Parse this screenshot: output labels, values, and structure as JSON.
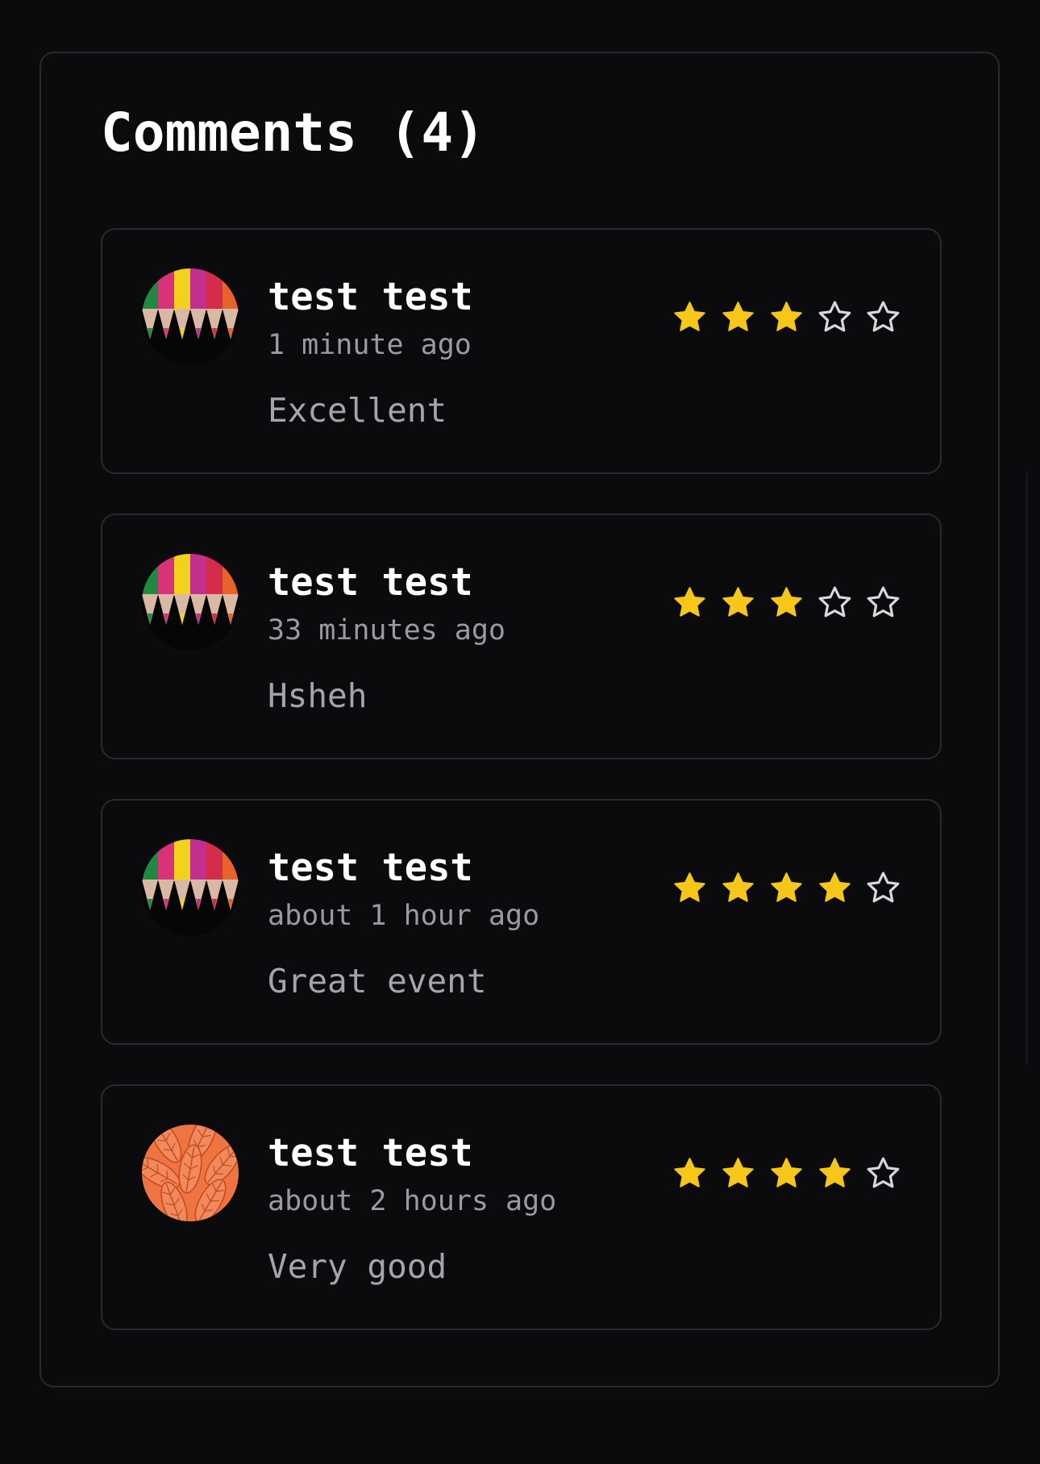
{
  "comments_section": {
    "title": "Comments (4)",
    "comments": [
      {
        "author": "test test",
        "time": "1 minute ago",
        "text": "Excellent",
        "rating": 3,
        "max_rating": 5,
        "avatar": "colored-pencils-avatar"
      },
      {
        "author": "test test",
        "time": "33 minutes ago",
        "text": "Hsheh",
        "rating": 3,
        "max_rating": 5,
        "avatar": "colored-pencils-avatar"
      },
      {
        "author": "test test",
        "time": "about 1 hour ago",
        "text": "Great event",
        "rating": 4,
        "max_rating": 5,
        "avatar": "colored-pencils-avatar"
      },
      {
        "author": "test test",
        "time": "about 2 hours ago",
        "text": "Very good",
        "rating": 4,
        "max_rating": 5,
        "avatar": "orange-leaf-pattern-avatar"
      }
    ]
  },
  "colors": {
    "background": "#0b0b0d",
    "border": "#2a2a2e",
    "star_filled": "#f6c619",
    "star_empty_stroke": "#d8d8dc",
    "primary_text": "#ffffff",
    "secondary_text": "#9a9aa0"
  }
}
